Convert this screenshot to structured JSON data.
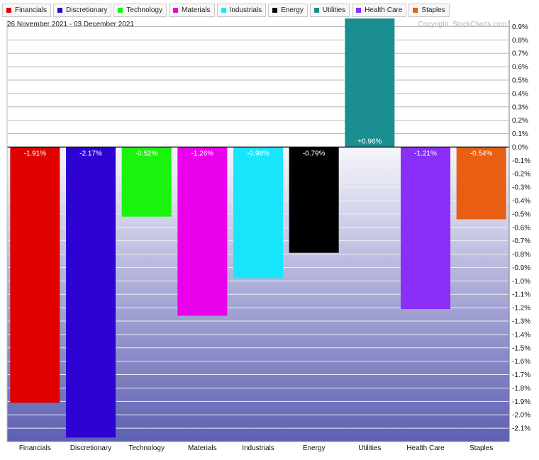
{
  "legend": [
    {
      "label": "Financials",
      "color": "#e00000"
    },
    {
      "label": "Discretionary",
      "color": "#2e02d2"
    },
    {
      "label": "Technology",
      "color": "#1af40d"
    },
    {
      "label": "Materials",
      "color": "#ea00ea"
    },
    {
      "label": "Industrials",
      "color": "#19e6fd"
    },
    {
      "label": "Energy",
      "color": "#000000"
    },
    {
      "label": "Utilities",
      "color": "#1b8e92"
    },
    {
      "label": "Health Care",
      "color": "#8a2ffa"
    },
    {
      "label": "Staples",
      "color": "#e85e12"
    }
  ],
  "date_range": "26 November 2021 - 03 December 2021",
  "copyright": "Copyright, StockCharts.com",
  "chart_data": {
    "type": "bar",
    "categories": [
      "Financials",
      "Discretionary",
      "Technology",
      "Materials",
      "Industrials",
      "Energy",
      "Utilities",
      "Health Care",
      "Staples"
    ],
    "values": [
      -1.91,
      -2.17,
      -0.52,
      -1.26,
      -0.98,
      -0.79,
      0.96,
      -1.21,
      -0.54
    ],
    "data_labels": [
      "-1.91%",
      "-2.17%",
      "-0.52%",
      "-1.26%",
      "-0.98%",
      "-0.79%",
      "+0.96%",
      "-1.21%",
      "-0.54%"
    ],
    "colors": [
      "#e00000",
      "#2e02d2",
      "#1af40d",
      "#ea00ea",
      "#19e6fd",
      "#000000",
      "#1b8e92",
      "#8a2ffa",
      "#e85e12"
    ],
    "ylim": [
      -2.2,
      0.95
    ],
    "yticks": [
      0.9,
      0.8,
      0.7,
      0.6,
      0.5,
      0.4,
      0.3,
      0.2,
      0.1,
      0.0,
      -0.1,
      -0.2,
      -0.3,
      -0.4,
      -0.5,
      -0.6,
      -0.7,
      -0.8,
      -0.9,
      -1.0,
      -1.1,
      -1.2,
      -1.3,
      -1.4,
      -1.5,
      -1.6,
      -1.7,
      -1.8,
      -1.9,
      -2.0,
      -2.1
    ],
    "ytick_labels": [
      "0.9%",
      "0.8%",
      "0.7%",
      "0.6%",
      "0.5%",
      "0.4%",
      "0.3%",
      "0.2%",
      "0.1%",
      "0.0%",
      "-0.1%",
      "-0.2%",
      "-0.3%",
      "-0.4%",
      "-0.5%",
      "-0.6%",
      "-0.7%",
      "-0.8%",
      "-0.9%",
      "-1.0%",
      "-1.1%",
      "-1.2%",
      "-1.3%",
      "-1.4%",
      "-1.5%",
      "-1.6%",
      "-1.7%",
      "-1.8%",
      "-1.9%",
      "-2.0%",
      "-2.1%"
    ],
    "grid": true,
    "legend_position": "top-left"
  }
}
